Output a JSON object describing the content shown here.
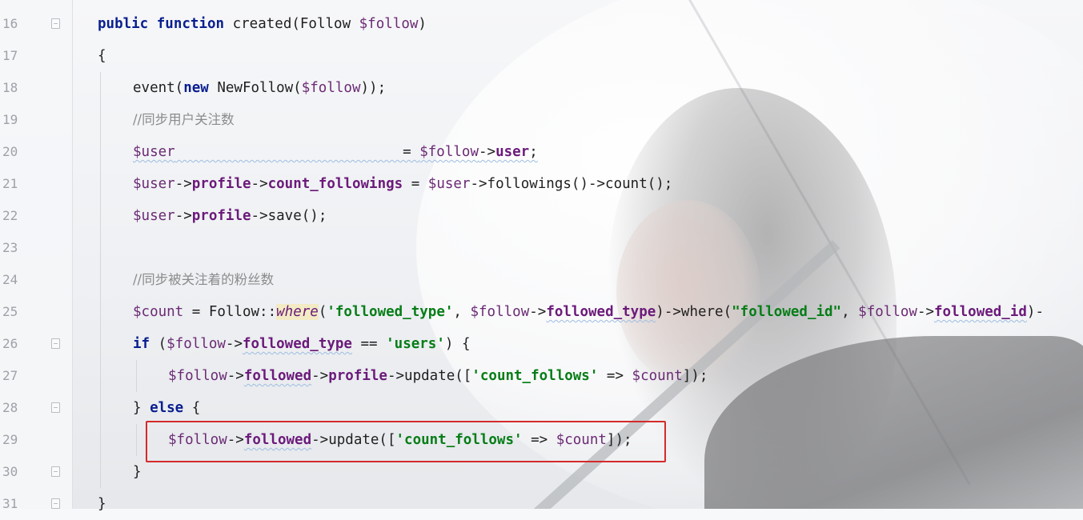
{
  "editor": {
    "lines": [
      {
        "number": "16",
        "fold": true,
        "indent": 0,
        "tokens": [
          {
            "t": "public",
            "c": "kw"
          },
          {
            "t": " ",
            "c": ""
          },
          {
            "t": "function",
            "c": "kw"
          },
          {
            "t": " created(Follow ",
            "c": ""
          },
          {
            "t": "$follow",
            "c": "var"
          },
          {
            "t": ")",
            "c": ""
          }
        ]
      },
      {
        "number": "17",
        "fold": false,
        "indent": 0,
        "tokens": [
          {
            "t": "{",
            "c": ""
          }
        ]
      },
      {
        "number": "18",
        "fold": false,
        "indent": 1,
        "tokens": [
          {
            "t": "event(",
            "c": ""
          },
          {
            "t": "new",
            "c": "kw"
          },
          {
            "t": " NewFollow(",
            "c": ""
          },
          {
            "t": "$follow",
            "c": "var"
          },
          {
            "t": "));",
            "c": ""
          }
        ]
      },
      {
        "number": "19",
        "fold": false,
        "indent": 1,
        "tokens": [
          {
            "t": "//同步用户关注数",
            "c": "cmt"
          }
        ]
      },
      {
        "number": "20",
        "fold": false,
        "indent": 1,
        "tokens": [
          {
            "t": "$user",
            "c": "var wavy"
          },
          {
            "t": "                           = ",
            "c": "wavy"
          },
          {
            "t": "$follow",
            "c": "var wavy"
          },
          {
            "t": "->",
            "c": "wavy"
          },
          {
            "t": "user",
            "c": "prop wavy"
          },
          {
            "t": ";",
            "c": "wavy"
          }
        ]
      },
      {
        "number": "21",
        "fold": false,
        "indent": 1,
        "tokens": [
          {
            "t": "$user",
            "c": "var"
          },
          {
            "t": "->",
            "c": ""
          },
          {
            "t": "profile",
            "c": "prop"
          },
          {
            "t": "->",
            "c": ""
          },
          {
            "t": "count_followings",
            "c": "prop"
          },
          {
            "t": " = ",
            "c": ""
          },
          {
            "t": "$user",
            "c": "var"
          },
          {
            "t": "->followings()->count();",
            "c": ""
          }
        ]
      },
      {
        "number": "22",
        "fold": false,
        "indent": 1,
        "tokens": [
          {
            "t": "$user",
            "c": "var"
          },
          {
            "t": "->",
            "c": ""
          },
          {
            "t": "profile",
            "c": "prop"
          },
          {
            "t": "->save();",
            "c": ""
          }
        ]
      },
      {
        "number": "23",
        "fold": false,
        "indent": 1,
        "tokens": []
      },
      {
        "number": "24",
        "fold": false,
        "indent": 1,
        "tokens": [
          {
            "t": "//同步被关注着的粉丝数",
            "c": "cmt"
          }
        ]
      },
      {
        "number": "25",
        "fold": false,
        "indent": 1,
        "tokens": [
          {
            "t": "$count",
            "c": "var"
          },
          {
            "t": " = Follow::",
            "c": ""
          },
          {
            "t": "where",
            "c": "it"
          },
          {
            "t": "(",
            "c": ""
          },
          {
            "t": "'followed_type'",
            "c": "str"
          },
          {
            "t": ", ",
            "c": ""
          },
          {
            "t": "$follow",
            "c": "var"
          },
          {
            "t": "->",
            "c": ""
          },
          {
            "t": "followed_type",
            "c": "prop wavy"
          },
          {
            "t": ")->where(",
            "c": ""
          },
          {
            "t": "\"followed_id\"",
            "c": "str"
          },
          {
            "t": ", ",
            "c": ""
          },
          {
            "t": "$follow",
            "c": "var"
          },
          {
            "t": "->",
            "c": ""
          },
          {
            "t": "followed_id",
            "c": "prop wavy"
          },
          {
            "t": ")-",
            "c": ""
          }
        ]
      },
      {
        "number": "26",
        "fold": true,
        "indent": 1,
        "tokens": [
          {
            "t": "if",
            "c": "kw"
          },
          {
            "t": " (",
            "c": ""
          },
          {
            "t": "$follow",
            "c": "var"
          },
          {
            "t": "->",
            "c": ""
          },
          {
            "t": "followed_type",
            "c": "prop wavy"
          },
          {
            "t": " == ",
            "c": ""
          },
          {
            "t": "'users'",
            "c": "str"
          },
          {
            "t": ") {",
            "c": ""
          }
        ]
      },
      {
        "number": "27",
        "fold": false,
        "indent": 2,
        "tokens": [
          {
            "t": "$follow",
            "c": "var"
          },
          {
            "t": "->",
            "c": ""
          },
          {
            "t": "followed",
            "c": "prop wavy"
          },
          {
            "t": "->",
            "c": ""
          },
          {
            "t": "profile",
            "c": "prop"
          },
          {
            "t": "->update([",
            "c": ""
          },
          {
            "t": "'count_follows'",
            "c": "str"
          },
          {
            "t": " => ",
            "c": ""
          },
          {
            "t": "$count",
            "c": "var"
          },
          {
            "t": "]);",
            "c": ""
          }
        ]
      },
      {
        "number": "28",
        "fold": true,
        "indent": 1,
        "tokens": [
          {
            "t": "} ",
            "c": ""
          },
          {
            "t": "else",
            "c": "kw"
          },
          {
            "t": " {",
            "c": ""
          }
        ]
      },
      {
        "number": "29",
        "fold": false,
        "indent": 2,
        "tokens": [
          {
            "t": "$follow",
            "c": "var"
          },
          {
            "t": "->",
            "c": ""
          },
          {
            "t": "followed",
            "c": "prop wavy"
          },
          {
            "t": "->update([",
            "c": ""
          },
          {
            "t": "'count_follows'",
            "c": "str"
          },
          {
            "t": " => ",
            "c": ""
          },
          {
            "t": "$count",
            "c": "var"
          },
          {
            "t": "]);",
            "c": ""
          }
        ]
      },
      {
        "number": "30",
        "fold": true,
        "indent": 1,
        "tokens": [
          {
            "t": "}",
            "c": ""
          }
        ]
      },
      {
        "number": "31",
        "fold": true,
        "indent": 0,
        "tokens": [
          {
            "t": "}",
            "c": ""
          }
        ]
      }
    ],
    "highlight_color": "#d42a2a"
  }
}
